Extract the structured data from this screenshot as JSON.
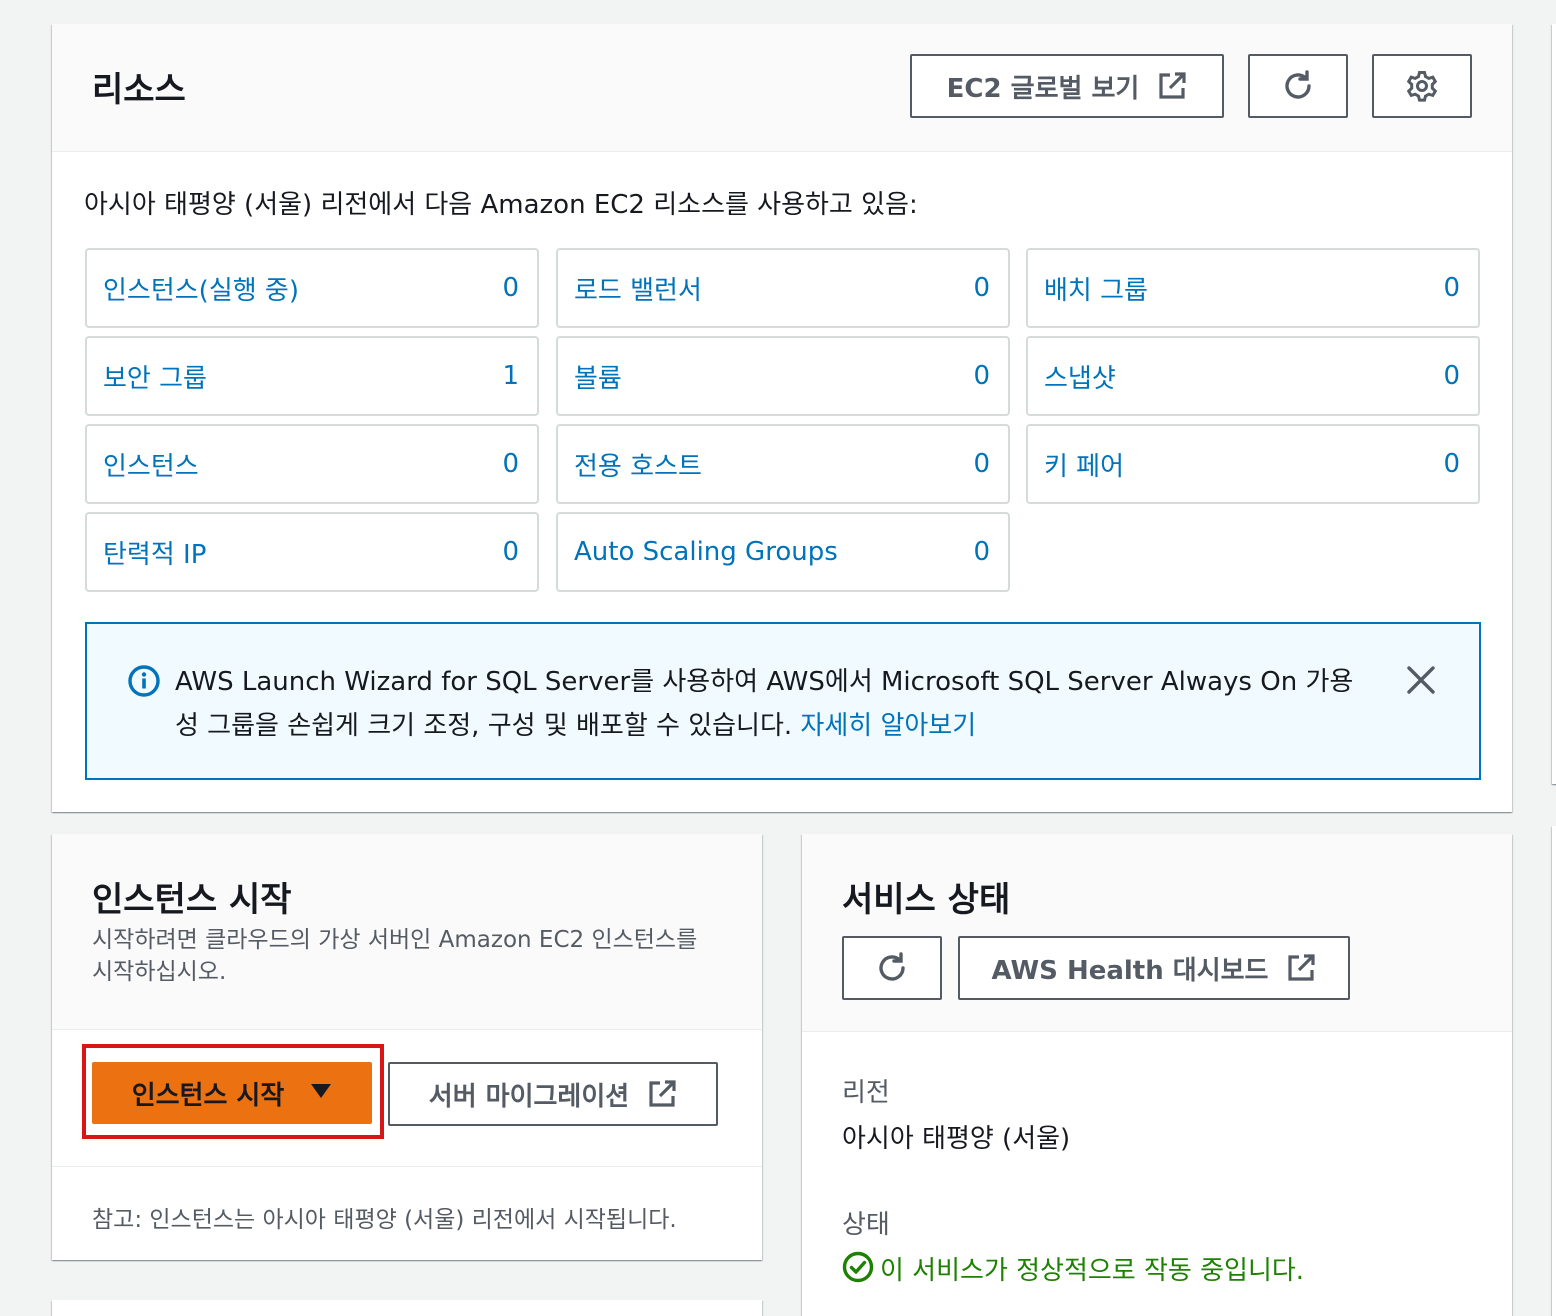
{
  "resources": {
    "title": "리소스",
    "global_view_label": "EC2 글로벌 보기",
    "description": "아시아 태평양 (서울) 리전에서 다음 Amazon EC2 리소스를 사용하고 있음:",
    "items": [
      {
        "label": "인스턴스(실행 중)",
        "count": "0"
      },
      {
        "label": "로드 밸런서",
        "count": "0"
      },
      {
        "label": "배치 그룹",
        "count": "0"
      },
      {
        "label": "보안 그룹",
        "count": "1"
      },
      {
        "label": "볼륨",
        "count": "0"
      },
      {
        "label": "스냅샷",
        "count": "0"
      },
      {
        "label": "인스턴스",
        "count": "0"
      },
      {
        "label": "전용 호스트",
        "count": "0"
      },
      {
        "label": "키 페어",
        "count": "0"
      },
      {
        "label": "탄력적 IP",
        "count": "0"
      },
      {
        "label": "Auto Scaling Groups",
        "count": "0"
      }
    ],
    "info": {
      "text": "AWS Launch Wizard for SQL Server를 사용하여 AWS에서 Microsoft SQL Server Always On 가용성 그룹을 손쉽게 크기 조정, 구성 및 배포할 수 있습니다. ",
      "link": "자세히 알아보기"
    }
  },
  "launch": {
    "title": "인스턴스 시작",
    "description": "시작하려면 클라우드의 가상 서버인 Amazon EC2 인스턴스를 시작하십시오.",
    "launch_button": "인스턴스 시작",
    "migrate_button": "서버 마이그레이션",
    "note": "참고: 인스턴스는 아시아 태평양 (서울) 리전에서 시작됩니다."
  },
  "service_health": {
    "title": "서비스 상태",
    "dashboard_button": "AWS Health 대시보드",
    "region_label": "리전",
    "region_value": "아시아 태평양 (서울)",
    "status_label": "상태",
    "status_value": "이 서비스가 정상적으로 작동 중입니다."
  },
  "colors": {
    "link": "#0073bb",
    "primary_button": "#ec7211",
    "success": "#1d8102",
    "highlight_outline": "#d91515",
    "info_background": "#f1faff"
  }
}
